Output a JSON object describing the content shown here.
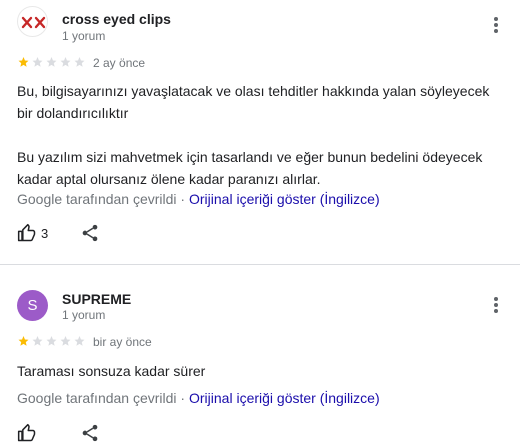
{
  "reviews": [
    {
      "author": "cross eyed clips",
      "review_count": "1 yorum",
      "rating": 1,
      "max_rating": 5,
      "time": "2 ay önce",
      "paragraphs": [
        "Bu, bilgisayarınızı yavaşlatacak ve olası tehditler hakkında yalan söyleyecek bir dolandırıcılıktır",
        "Bu yazılım sizi mahvetmek için tasarlandı ve eğer bunun bedelini ödeyecek kadar aptal olursanız ölene kadar paranızı alırlar."
      ],
      "translated_by": "Google tarafından çevrildi",
      "separator": " · ",
      "show_original": "Orijinal içeriği göster (İngilizce)",
      "likes": "3",
      "avatar_icon": "xx-logo-icon"
    },
    {
      "author": "SUPREME",
      "avatar_letter": "S",
      "avatar_color": "#9c5bc8",
      "review_count": "1 yorum",
      "rating": 1,
      "max_rating": 5,
      "time": "bir ay önce",
      "paragraphs": [
        "Taraması sonsuza kadar sürer"
      ],
      "translated_by": "Google tarafından çevrildi",
      "separator": " · ",
      "show_original": "Orijinal içeriği göster (İngilizce)",
      "likes": ""
    }
  ],
  "colors": {
    "star_filled": "#fbbc04",
    "star_empty": "#dadce0",
    "link": "#1a0dab",
    "secondary_text": "#70757a"
  }
}
